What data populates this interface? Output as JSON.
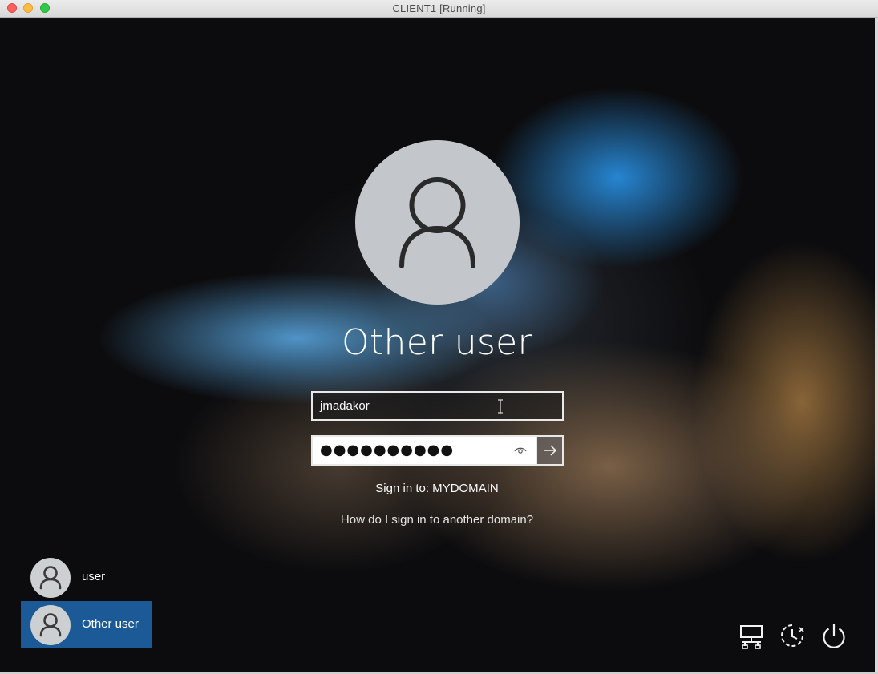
{
  "window": {
    "title": "CLIENT1 [Running]"
  },
  "login": {
    "display_name": "Other user",
    "username_value": "jmadakor",
    "password_masked": "●●●●●●●●●●",
    "sign_in_to": "Sign in to: MYDOMAIN",
    "other_domain_link": "How do I sign in to another domain?"
  },
  "user_list": [
    {
      "label": "user",
      "selected": false
    },
    {
      "label": "Other user",
      "selected": true
    }
  ],
  "system_icons": [
    "network-icon",
    "ease-of-access-icon",
    "power-icon"
  ],
  "colors": {
    "selected_tile": "#1b5a97",
    "avatar_bg": "#c3c7cb",
    "text": "#ffffff"
  }
}
